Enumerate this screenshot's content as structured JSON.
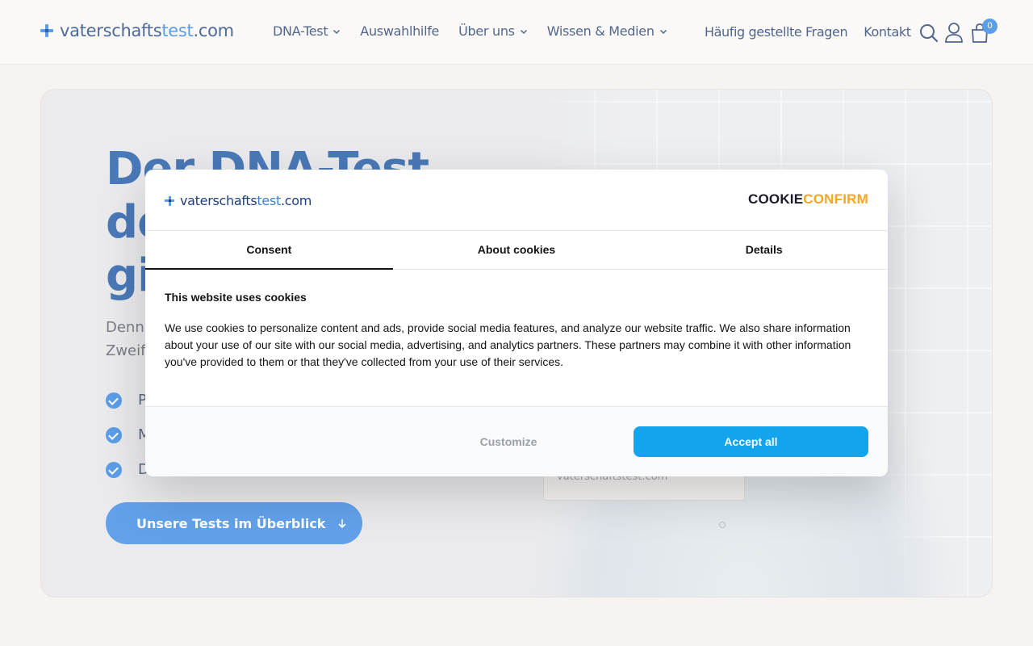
{
  "header": {
    "logo_part1": "vaterschafts",
    "logo_part2": "test",
    "logo_part3": ".com",
    "nav": [
      {
        "label": "DNA-Test",
        "dropdown": true
      },
      {
        "label": "Auswahlhilfe",
        "dropdown": false
      },
      {
        "label": "Über uns",
        "dropdown": true
      },
      {
        "label": "Wissen & Medien",
        "dropdown": true
      }
    ],
    "faq_label": "Häufig gestellte Fragen",
    "contact_label": "Kontakt",
    "cart_count": "0",
    "icons": [
      "search-icon",
      "user-icon",
      "cart-icon"
    ]
  },
  "hero": {
    "title": "Der DNA-Test\nde\ngi",
    "subtitle": "Denn\nZweif",
    "checks": [
      "P",
      "M",
      "D"
    ],
    "button_label": "Unsere Tests im Überblick",
    "badge_text": "vaterschaftstest.com"
  },
  "cookie_dialog": {
    "logo_part1": "vaterschafts",
    "logo_part2": "test",
    "logo_part3": ".com",
    "brand_part1": "C",
    "brand_part2": "OOKIE",
    "brand_part3": "CONFIRM",
    "tabs": [
      {
        "label": "Consent",
        "active": true
      },
      {
        "label": "About cookies",
        "active": false
      },
      {
        "label": "Details",
        "active": false
      }
    ],
    "heading": "This website uses cookies",
    "body": "We use cookies to personalize content and ads, provide social media features, and analyze our website traffic. We also share information about your use of our site with our social media, advertising, and analytics partners. These partners may combine it with other information you've provided to them or that they've collected from your use of their services.",
    "customize_label": "Customize",
    "accept_label": "Accept all"
  },
  "colors": {
    "accent": "#5b9ee8",
    "nav_text": "#51668c",
    "accept_button": "#12a4ec",
    "hero_title": "#4a79b8",
    "cookieconfirm_orange": "#f5a623"
  }
}
